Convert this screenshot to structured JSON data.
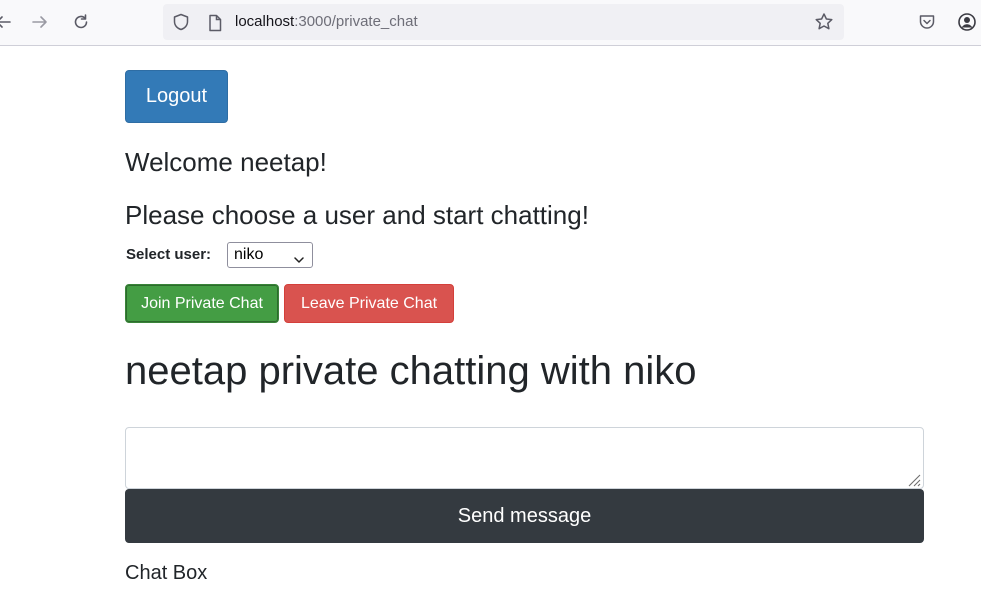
{
  "browser": {
    "url_host": "localhost",
    "url_path": ":3000/private_chat",
    "icons": [
      "back-arrow-icon",
      "forward-arrow-icon",
      "reload-icon",
      "shield-icon",
      "page-icon",
      "bookmark-star-icon",
      "pocket-icon",
      "account-icon"
    ]
  },
  "page": {
    "logout_label": "Logout",
    "welcome_text": "Welcome neetap!",
    "choose_text": "Please choose a user and start chatting!",
    "select_label": "Select user:",
    "select_value": "niko",
    "join_label": "Join Private Chat",
    "leave_label": "Leave Private Chat",
    "chat_heading": "neetap private chatting with niko",
    "message_value": "",
    "send_label": "Send message",
    "chat_box_label": "Chat Box"
  },
  "colors": {
    "primary": "#337ab7",
    "success": "#449d44",
    "danger": "#d9534f",
    "dark": "#343a40"
  }
}
